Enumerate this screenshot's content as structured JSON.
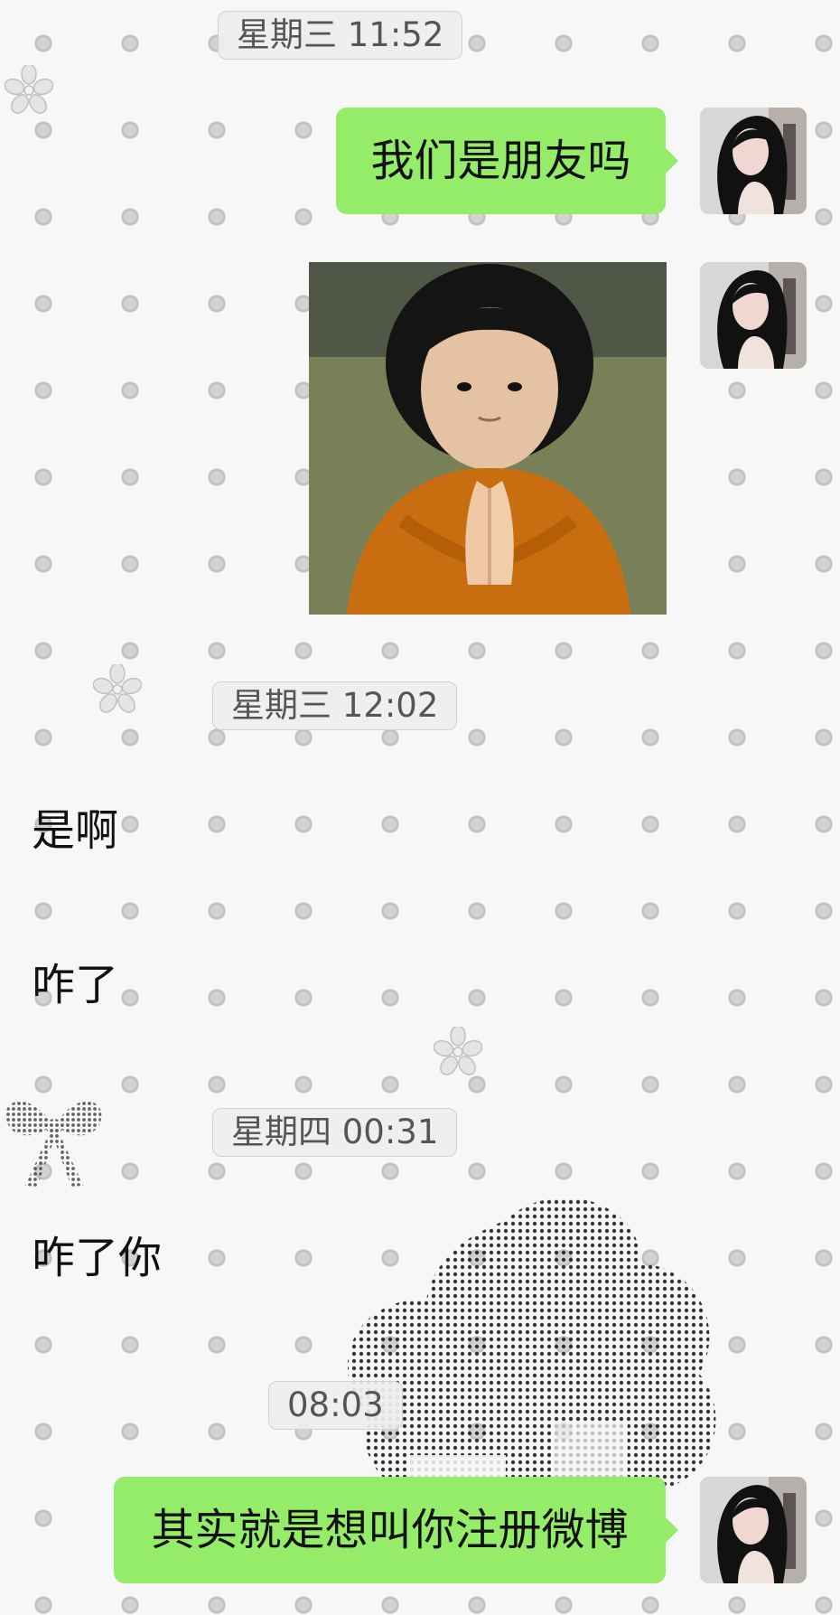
{
  "chat": {
    "timestamps": [
      "星期三 11:52",
      "星期三 12:02",
      "星期四 00:31",
      "08:03"
    ],
    "messages": {
      "outgoing_1": "我们是朋友吗",
      "incoming_1": "是啊",
      "incoming_2": "咋了",
      "incoming_3": "咋了你",
      "outgoing_2": "其实就是想叫你注册微博"
    },
    "sticker": {
      "icon": "praying-child-sticker"
    }
  },
  "theme": {
    "outgoing_bubble_color": "#95ec69",
    "background_color": "#f7f7f7"
  }
}
